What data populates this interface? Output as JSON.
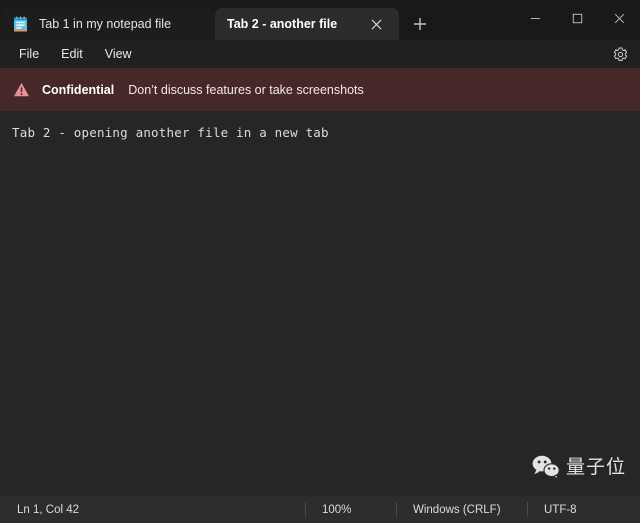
{
  "window": {
    "controls": [
      {
        "name": "minimize",
        "label": "Minimize",
        "icon": "minimize-icon"
      },
      {
        "name": "maximize",
        "label": "Maximize",
        "icon": "maximize-icon"
      },
      {
        "name": "close",
        "label": "Close",
        "icon": "close-icon"
      }
    ]
  },
  "tabs": [
    {
      "label": "Tab 1 in my notepad file",
      "active": false,
      "icon": "notepad-document-icon",
      "has_close": false
    },
    {
      "label": "Tab 2 - another file",
      "active": true,
      "icon": "none",
      "has_close": true,
      "close_icon": "close-icon"
    }
  ],
  "newtab": {
    "label": "New tab",
    "icon": "plus-icon"
  },
  "menubar": {
    "items": [
      {
        "label": "File"
      },
      {
        "label": "Edit"
      },
      {
        "label": "View"
      }
    ],
    "settings": {
      "label": "Settings",
      "icon": "gear-icon"
    }
  },
  "banner": {
    "icon": "warning-triangle-icon",
    "title": "Confidential",
    "message": "Don’t discuss features or take screenshots",
    "background": "#452827",
    "icon_color": "#e8909a",
    "text_color": "#ffffff"
  },
  "editor": {
    "content": "Tab 2 - opening another file in a new tab",
    "background": "#262626",
    "text_color": "#dcdcdc"
  },
  "watermark": {
    "logo": "wechat-logo-icon",
    "text": "量子位"
  },
  "statusbar": {
    "cursor_position": "Ln 1, Col 42",
    "zoom_level": "100%",
    "line_ending": "Windows (CRLF)",
    "encoding": "UTF-8",
    "background": "#2d2d2d"
  },
  "colors": {
    "titlebar": "#191919",
    "tab_active": "#2b2b2b",
    "tab_inactive": "#1d1d1d",
    "menubar": "#202020",
    "accent_icon": "#4fc3ea"
  }
}
